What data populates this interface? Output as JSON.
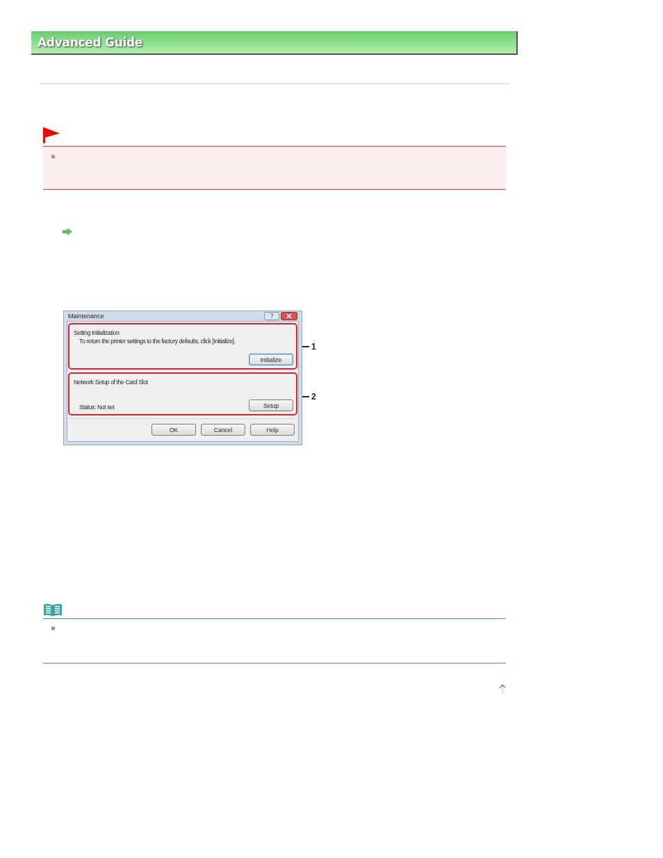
{
  "header": {
    "title": "Advanced Guide"
  },
  "dialog": {
    "title": "Maintenance",
    "groups": [
      {
        "title": "Setting Initialization",
        "text": "To return the printer settings to the factory defaults, click [Initialize].",
        "button": "Initialize",
        "focused": true,
        "callout": "1"
      },
      {
        "title": "Network Setup of the Card Slot",
        "text": "Status: Not set",
        "button": "Setup",
        "focused": false,
        "callout": "2"
      }
    ],
    "buttons": [
      "OK",
      "Cancel",
      "Help"
    ]
  }
}
